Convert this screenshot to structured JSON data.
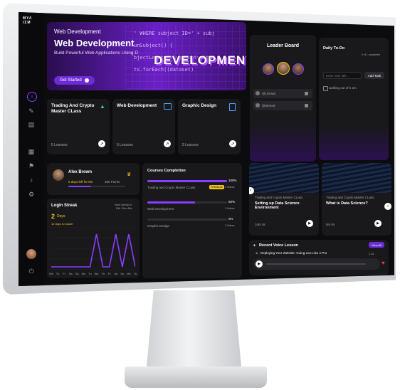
{
  "brand": {
    "logo": "ΜΥΛ\nΙΣΜ"
  },
  "hero": {
    "eyebrow": "Web Development",
    "title": "Web Development",
    "subtitle": "Build Powerful Web Applications Using D",
    "cta": "Get Started",
    "banner_word": "DEVELOPMENT",
    "code_lines": [
      "' WHERE subject_ID=' + subj",
      "unSubject() {",
      "bjectLength = datasetsWithS",
      "ts.forEach((dataset)"
    ]
  },
  "courses": [
    {
      "title": "Trading And Crypto Master CLass",
      "lessons": "5 Lessons"
    },
    {
      "title": "Web Development",
      "lessons": "5 Lessons"
    },
    {
      "title": "Graphic Design",
      "lessons": "5 Lessons"
    }
  ],
  "leaderboard": {
    "title": "Leader Board",
    "rows": [
      {
        "name": "@r.brown"
      },
      {
        "name": "@ahmed"
      }
    ]
  },
  "todo": {
    "title": "Daily To-Do",
    "counter": "0 of 1 completed",
    "placeholder": "Enter task title...",
    "add_label": "Add Task",
    "item": "walking out of 5 am"
  },
  "profile": {
    "name": "Alex Brown",
    "streak_text": "0 days left for the",
    "points": "380 Points"
  },
  "login_streak": {
    "title": "Login Streak",
    "meta": "Next streak in\n15h 11m 46s",
    "days_value": "2",
    "days_unit": "Days",
    "note": "12 days to boost!",
    "days": [
      "We",
      "Th",
      "Fr",
      "Sa",
      "Su",
      "Mo",
      "Tu",
      "We",
      "Th",
      "Fr",
      "Sa",
      "Su",
      "Mo",
      "Tu"
    ],
    "values": [
      0,
      0,
      0,
      0,
      0,
      0,
      0,
      1,
      0,
      0,
      1,
      0,
      1,
      0
    ]
  },
  "completion": {
    "title": "Courses Completion",
    "items": [
      {
        "name": "Trading and Crypto Master CLass",
        "badge": "PREMIUM",
        "pct": "100%",
        "videos": "2 Videos",
        "fill": 1.0
      },
      {
        "name": "Web Development",
        "pct": "60%",
        "videos": "2 Videos",
        "fill": 0.6
      },
      {
        "name": "Graphic Design",
        "pct": "0%",
        "videos": "2 Videos",
        "fill": 0.0
      }
    ]
  },
  "videos": [
    {
      "category": "Trading and Crypto Master CLass",
      "title": "Setting up Data Science Environment",
      "duration": "10m 0s"
    },
    {
      "category": "Trading and Crypto Master CLass",
      "title": "What is Data Science?",
      "duration": "5m 0s"
    }
  ],
  "voice": {
    "title": "Recent Voice Lesson",
    "view_all": "View All",
    "track": "Deploying Your Website: Going Live Like A Pro",
    "speed": "1.5x"
  },
  "colors": {
    "accent": "#8b3dff",
    "bg": "#0c0c0e",
    "card": "#19191c",
    "gold": "#f5c518"
  }
}
